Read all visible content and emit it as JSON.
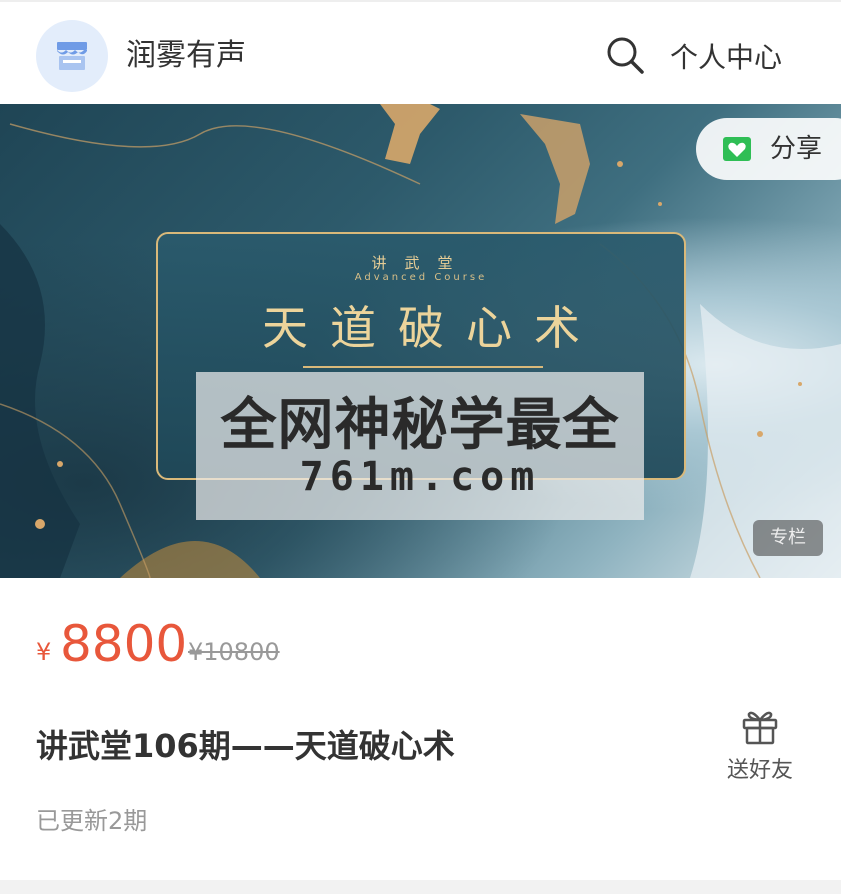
{
  "header": {
    "shop_name": "润雾有声",
    "search_icon": "search-icon",
    "personal_center_label": "个人中心"
  },
  "banner": {
    "card_small": "讲武堂",
    "card_sub": "Advanced Course",
    "card_title": "天道破心术",
    "watermark_line1": "全网神秘学最全",
    "watermark_line2": "761m.com",
    "share_label": "分享",
    "column_tag": "专栏"
  },
  "price": {
    "symbol": "¥",
    "current": "8800",
    "original": "¥10800",
    "color": "#e8573b"
  },
  "course": {
    "title": "讲武堂106期——天道破心术",
    "update_status": "已更新2期"
  },
  "gift": {
    "label": "送好友",
    "icon": "gift-icon"
  }
}
